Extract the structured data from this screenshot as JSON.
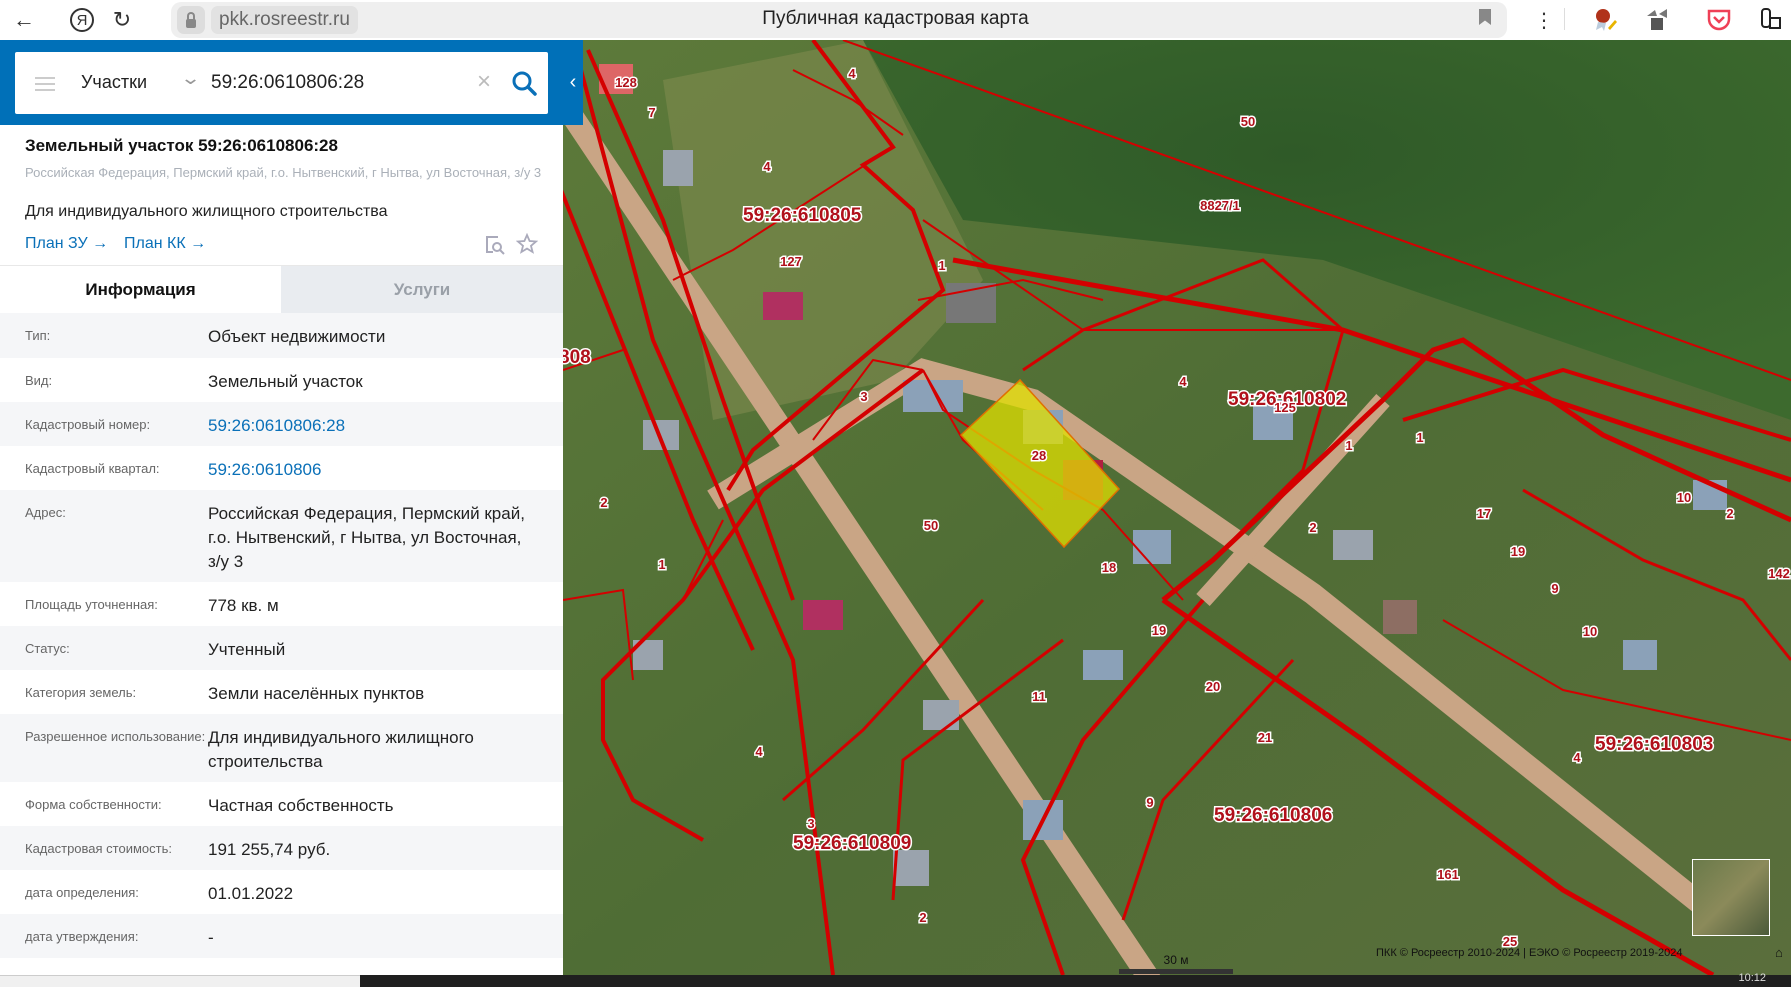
{
  "browser": {
    "url": "pkk.rosreestr.ru",
    "page_title": "Публичная кадастровая карта",
    "yandex_label": "Я"
  },
  "search": {
    "layer": "Участки",
    "query": "59:26:0610806:28"
  },
  "card": {
    "title": "Земельный участок 59:26:0610806:28",
    "address": "Российская Федерация, Пермский край, г.о. Нытвенский, г Нытва, ул Восточная, з/у 3",
    "purpose": "Для индивидуального жилищного строительства",
    "link_plan_zu": "План ЗУ →",
    "link_plan_kk": "План КК →"
  },
  "tabs": {
    "info": "Информация",
    "services": "Услуги"
  },
  "rows": [
    {
      "label": "Тип:",
      "value": "Объект недвижимости"
    },
    {
      "label": "Вид:",
      "value": "Земельный участок"
    },
    {
      "label": "Кадастровый номер:",
      "value": "59:26:0610806:28"
    },
    {
      "label": "Кадастровый квартал:",
      "value": "59:26:0610806"
    },
    {
      "label": "Адрес:",
      "value": "Российская Федерация, Пермский край, г.о. Нытвенский, г Нытва, ул Восточная, з/у 3"
    },
    {
      "label": "Площадь уточненная:",
      "value": "778 кв. м"
    },
    {
      "label": "Статус:",
      "value": "Учтенный"
    },
    {
      "label": "Категория земель:",
      "value": "Земли населённых пунктов"
    },
    {
      "label": "Разрешенное использование:",
      "value": "Для индивидуального жилищного строительства"
    },
    {
      "label": "Форма собственности:",
      "value": "Частная собственность"
    },
    {
      "label": "Кадастровая стоимость:",
      "value": "191 255,74 руб."
    },
    {
      "label": "дата определения:",
      "value": "01.01.2022"
    },
    {
      "label": "дата утверждения:",
      "value": "-"
    }
  ],
  "map": {
    "blocks": [
      "59:26:610805",
      "59:26:610802",
      "59:26:610803",
      "59:26:610806",
      "59:26:610809",
      "808"
    ],
    "parcels": [
      "128",
      "7",
      "4",
      "4",
      "127",
      "1",
      "3",
      "28",
      "50",
      "8827/1",
      "4",
      "125",
      "1",
      "1",
      "2",
      "17",
      "19",
      "9",
      "10",
      "10",
      "2",
      "142",
      "50",
      "18",
      "19",
      "20",
      "21",
      "11",
      "9",
      "4",
      "4",
      "2",
      "1",
      "2",
      "161",
      "25",
      "3"
    ],
    "scale": "30 м",
    "attribution": "ПКК © Росреестр 2010-2024 | ЕЭКО © Росреестр 2019-2024",
    "selected_color": "#e0e000",
    "boundary_color": "#d40000"
  },
  "taskbar": {
    "clock": "10:12"
  }
}
